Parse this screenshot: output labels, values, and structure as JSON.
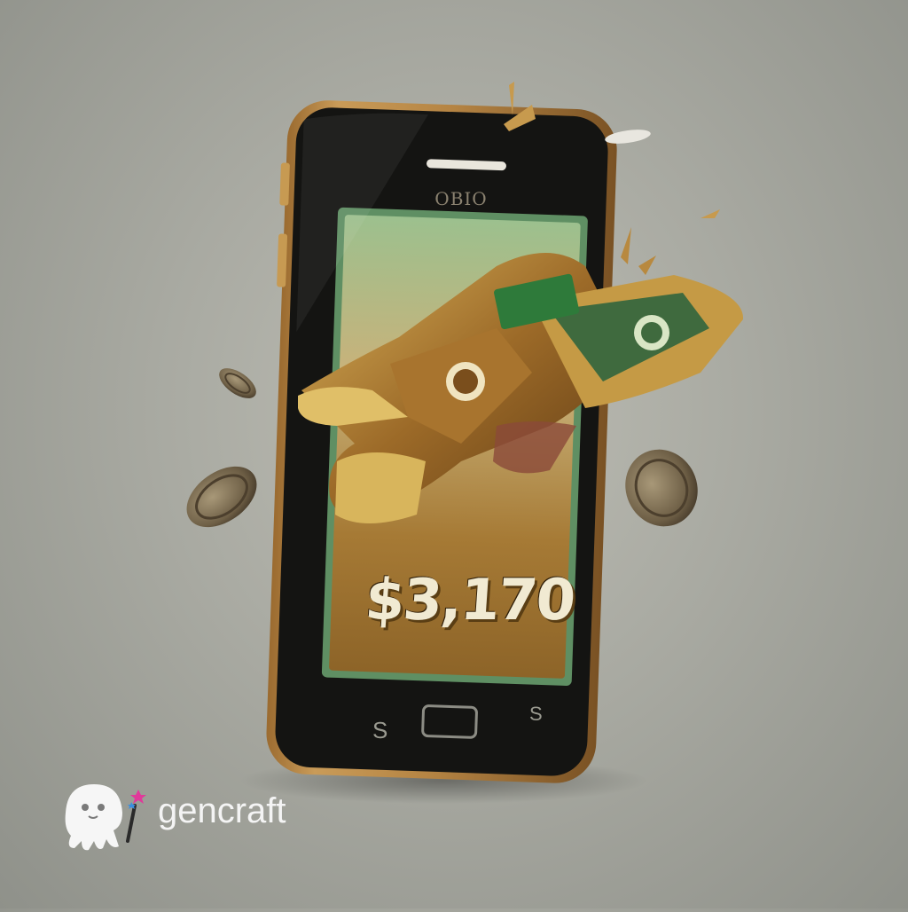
{
  "phone": {
    "brand_label": "OBIO",
    "screen_amount": "$3,170",
    "nav_left_label": "S",
    "nav_right_label": "S"
  },
  "watermark": {
    "text": "gencraft"
  },
  "colors": {
    "background": "#a9aaa2",
    "phone_body_gold": "#b88b48",
    "screen_green": "#7eaa79",
    "wallet_brown": "#8a5a22",
    "coin_bronze": "#6e5f44"
  }
}
